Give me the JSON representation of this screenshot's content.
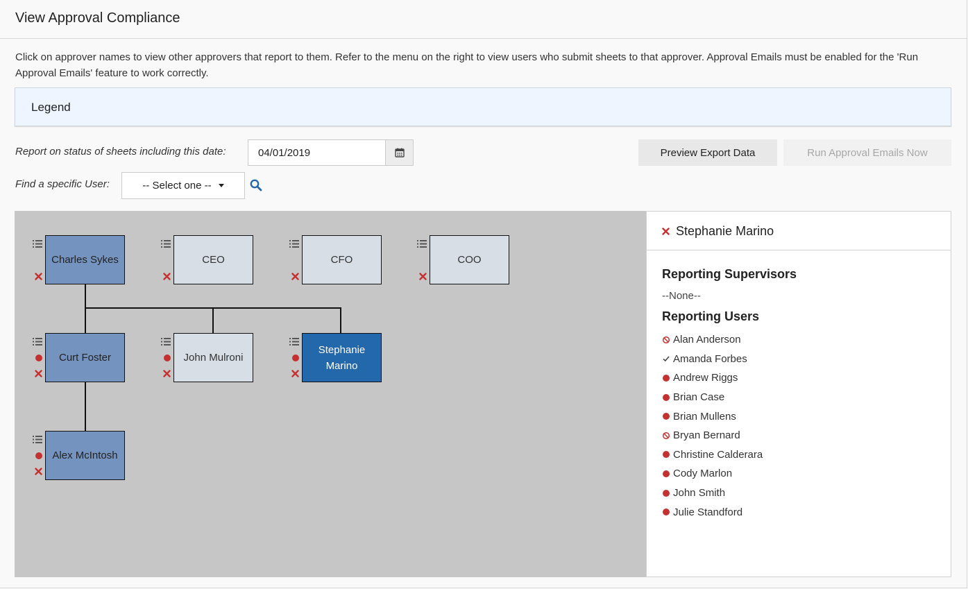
{
  "page": {
    "title": "View Approval Compliance",
    "intro": "Click on approver names to view other approvers that report to them. Refer to the menu on the right to view users who submit sheets to that approver. Approval Emails must be enabled for the 'Run Approval Emails' feature to work correctly."
  },
  "legend": {
    "label": "Legend"
  },
  "controls": {
    "date_label": "Report on status of sheets including this date:",
    "date_value": "04/01/2019",
    "preview_button": "Preview Export Data",
    "run_button": "Run Approval Emails Now",
    "find_label": "Find a specific User:",
    "select_value": "-- Select one --"
  },
  "chart": {
    "nodes": [
      {
        "id": "charles",
        "label": "Charles Sykes",
        "style": "blue"
      },
      {
        "id": "ceo",
        "label": "CEO",
        "style": "light"
      },
      {
        "id": "cfo",
        "label": "CFO",
        "style": "light"
      },
      {
        "id": "coo",
        "label": "COO",
        "style": "light"
      },
      {
        "id": "curt",
        "label": "Curt Foster",
        "style": "blue"
      },
      {
        "id": "john",
        "label": "John Mulroni",
        "style": "light"
      },
      {
        "id": "stephanie",
        "label": "Stephanie Marino",
        "style": "active"
      },
      {
        "id": "alex",
        "label": "Alex McIntosh",
        "style": "blue"
      }
    ],
    "colors": {
      "blue": "#7593bf",
      "light": "#d7dee6",
      "active": "#2368aa",
      "alert": "#c43131"
    }
  },
  "side_panel": {
    "selected_name": "Stephanie Marino",
    "supervisors_heading": "Reporting Supervisors",
    "supervisors_empty": "--None--",
    "users_heading": "Reporting Users",
    "users": [
      {
        "name": "Alan Anderson",
        "status": "blocked"
      },
      {
        "name": "Amanda Forbes",
        "status": "approved"
      },
      {
        "name": "Andrew Riggs",
        "status": "pending"
      },
      {
        "name": "Brian Case",
        "status": "pending"
      },
      {
        "name": "Brian Mullens",
        "status": "pending"
      },
      {
        "name": "Bryan Bernard",
        "status": "blocked"
      },
      {
        "name": "Christine Calderara",
        "status": "pending"
      },
      {
        "name": "Cody Marlon",
        "status": "pending"
      },
      {
        "name": "John Smith",
        "status": "pending"
      },
      {
        "name": "Julie Standford",
        "status": "pending"
      }
    ]
  }
}
